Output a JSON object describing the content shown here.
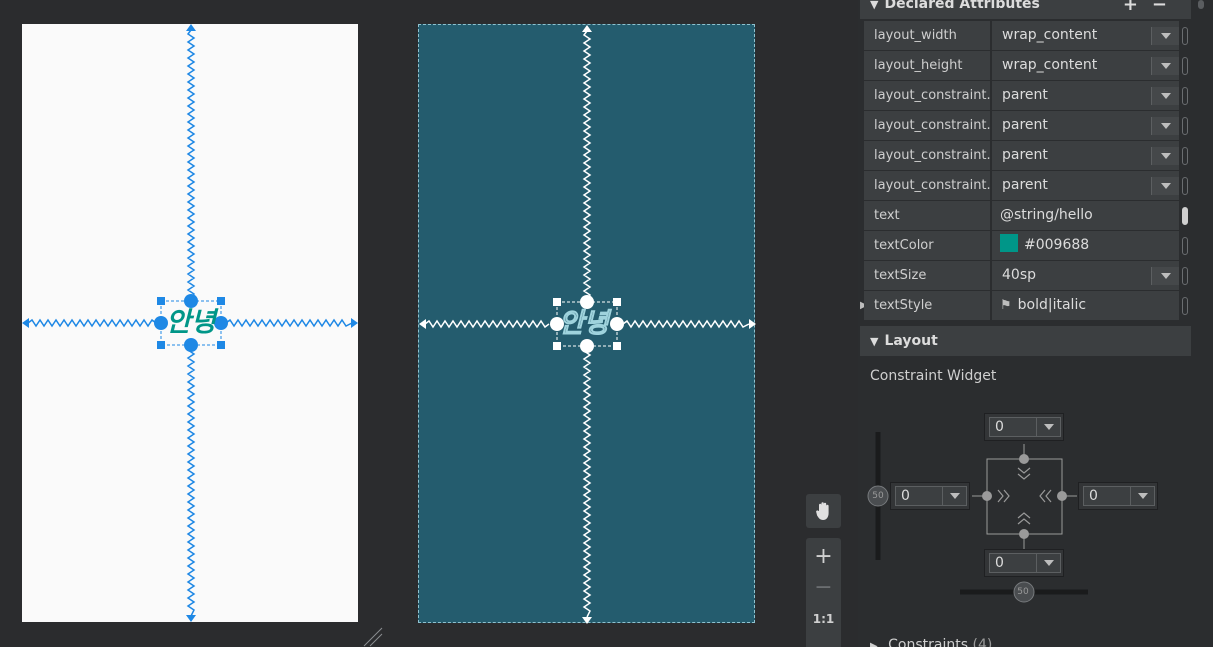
{
  "design_view": {
    "text": "안녕",
    "text_color": "#009688",
    "background": "#fafafa",
    "constraint_color": "#1e88e5"
  },
  "blueprint_view": {
    "text": "안녕",
    "background": "#245c6e"
  },
  "zoom_toolbar": {
    "pan_icon": "hand-icon",
    "zoom_in": "+",
    "zoom_out": "−",
    "zoom_fit": "1:1"
  },
  "declared_attributes": {
    "title": "Declared Attributes",
    "add": "+",
    "remove": "−",
    "rows": [
      {
        "name": "layout_width",
        "value": "wrap_content"
      },
      {
        "name": "layout_height",
        "value": "wrap_content"
      },
      {
        "name": "layout_constraint...",
        "value": "parent"
      },
      {
        "name": "layout_constraint...",
        "value": "parent"
      },
      {
        "name": "layout_constraint...",
        "value": "parent"
      },
      {
        "name": "layout_constraint...",
        "value": "parent"
      },
      {
        "name": "text",
        "value": "@string/hello"
      },
      {
        "name": "textColor",
        "value": "#009688",
        "swatch": "#009688"
      },
      {
        "name": "textSize",
        "value": "40sp"
      },
      {
        "name": "textStyle",
        "value": "bold|italic"
      }
    ]
  },
  "layout_section": {
    "title": "Layout",
    "widget_title": "Constraint Widget",
    "margin_top": "0",
    "margin_left": "0",
    "margin_right": "0",
    "margin_bottom": "0",
    "bias_vertical": "50",
    "bias_horizontal": "50"
  },
  "constraints_section": {
    "title": "Constraints",
    "count": "(4)"
  }
}
